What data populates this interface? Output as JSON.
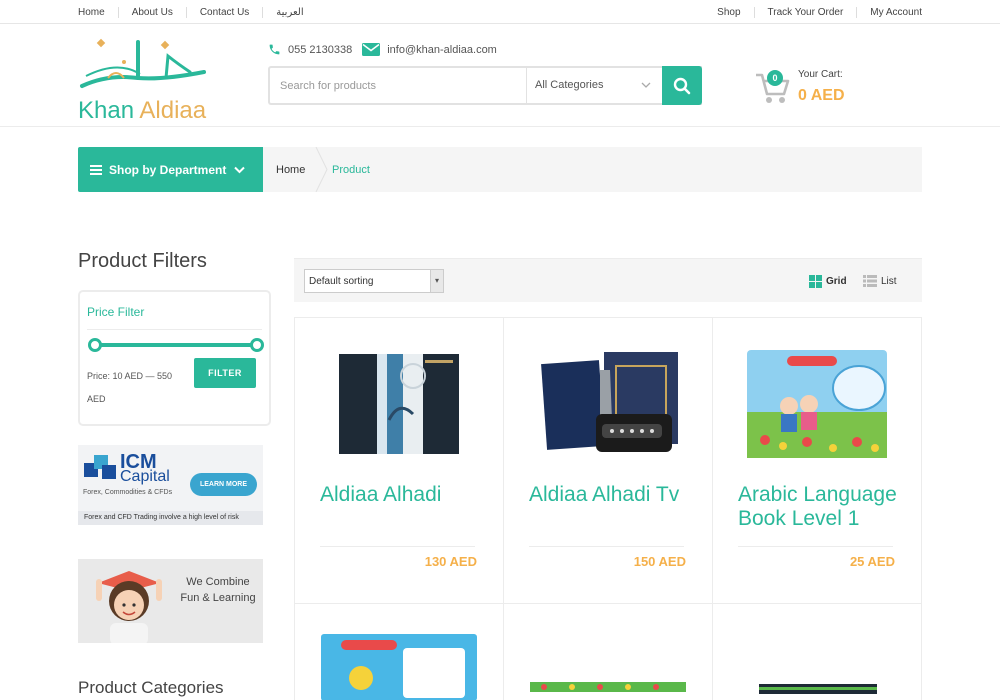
{
  "topbar": {
    "left_links": [
      "Home",
      "About Us",
      "Contact Us",
      "العربية"
    ],
    "right_links": [
      "Shop",
      "Track Your Order",
      "My Account"
    ]
  },
  "brand": {
    "name_part1": "Khan",
    "name_part2": " Aldiaa"
  },
  "contact": {
    "phone": "055 2130338",
    "email": "info@khan-aldiaa.com"
  },
  "search": {
    "placeholder": "Search for products",
    "category": "All Categories"
  },
  "cart": {
    "label": "Your Cart:",
    "amount": "0 AED",
    "count": "0"
  },
  "nav": {
    "department_label": "Shop by Department",
    "breadcrumb": [
      "Home",
      "Product"
    ]
  },
  "sidebar": {
    "filters_title": "Product Filters",
    "price_filter": {
      "heading": "Price Filter",
      "range_text": "Price: 10 AED — 550 AED",
      "button": "FILTER"
    },
    "ad_icm": {
      "brand_line1": "ICM",
      "brand_line2": "Capital",
      "tagline": "Forex, Commodities & CFDs",
      "cta": "LEARN MORE",
      "disclaimer": "Forex and CFD Trading involve a high level of risk"
    },
    "ad_kids": {
      "text": "We Combine Fun & Learning"
    },
    "categories_title": "Product Categories"
  },
  "toolbar": {
    "sorting": "Default sorting",
    "grid_label": "Grid",
    "list_label": "List"
  },
  "products": [
    {
      "name": "Aldiaa Alhadi",
      "price": "130 AED"
    },
    {
      "name": "Aldiaa Alhadi Tv",
      "price": "150 AED"
    },
    {
      "name": "Arabic Language Book Level 1",
      "price": "25 AED"
    }
  ],
  "colors": {
    "accent": "#2ab89a",
    "price": "#f5b04a",
    "logo_gold": "#e8b15a"
  }
}
